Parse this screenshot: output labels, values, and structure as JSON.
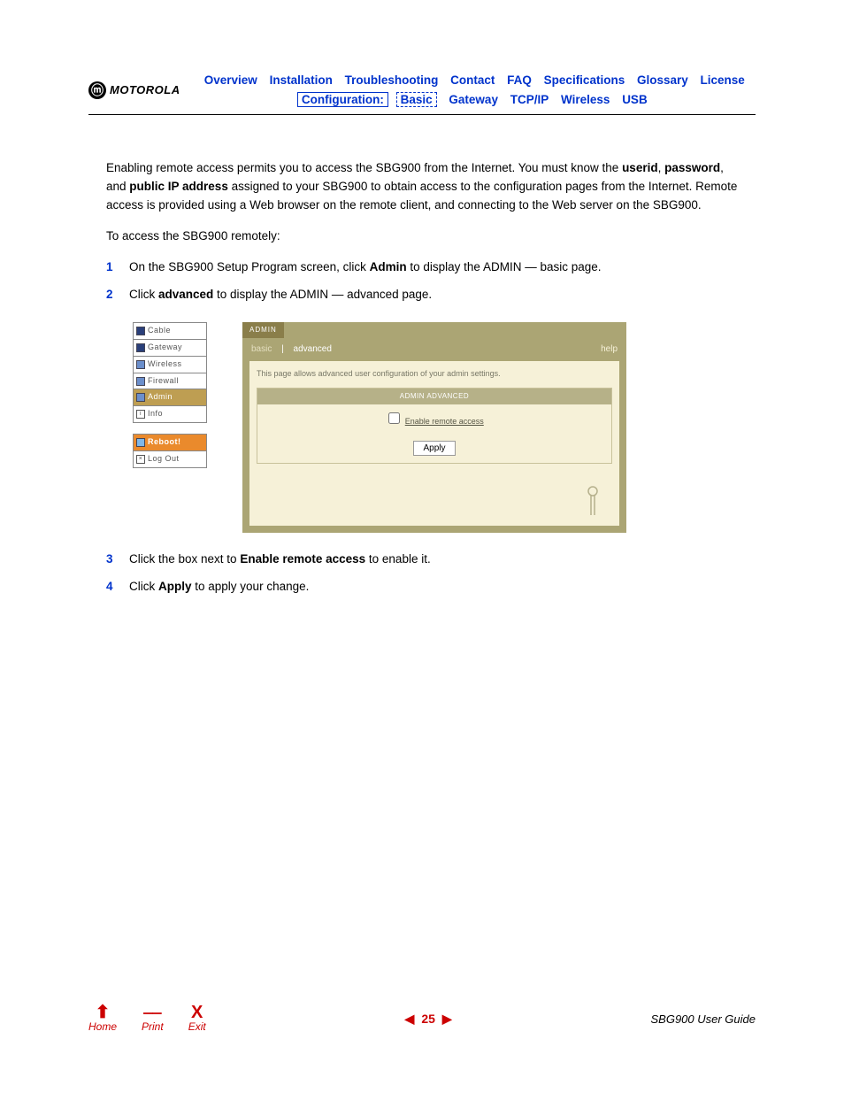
{
  "brand": "MOTOROLA",
  "nav": {
    "row1": [
      "Overview",
      "Installation",
      "Troubleshooting",
      "Contact",
      "FAQ",
      "Specifications",
      "Glossary",
      "License"
    ],
    "config_label": "Configuration:",
    "row2": [
      "Basic",
      "Gateway",
      "TCP/IP",
      "Wireless",
      "USB"
    ]
  },
  "body": {
    "p1a": "Enabling remote access permits you to access the SBG900 from the Internet. You must know the ",
    "p1_userid": "userid",
    "p1b": ", ",
    "p1_password": "password",
    "p1c": ", and ",
    "p1_pubip": "public IP address",
    "p1d": " assigned to your SBG900 to obtain access to the configuration pages from the Internet. Remote access is provided using a Web browser on the remote client, and connecting to the Web server on the SBG900.",
    "p2": "To access the SBG900 remotely:",
    "s1a": "On the SBG900 Setup Program screen, click ",
    "s1_admin": "Admin",
    "s1b": " to display the ADMIN — basic page.",
    "s2a": "Click ",
    "s2_adv": "advanced",
    "s2b": " to display the ADMIN — advanced page.",
    "s3a": "Click the box next to ",
    "s3_era": "Enable remote access",
    "s3b": " to enable it.",
    "s4a": "Click ",
    "s4_apply": "Apply",
    "s4b": " to apply your change."
  },
  "step_nums": [
    "1",
    "2",
    "3",
    "4"
  ],
  "side_menu": {
    "cable": "Cable",
    "gateway": "Gateway",
    "wireless": "Wireless",
    "firewall": "Firewall",
    "admin": "Admin",
    "info": "Info",
    "reboot": "Reboot!",
    "logout": "Log Out"
  },
  "admin_panel": {
    "tab": "ADMIN",
    "subtab_basic": "basic",
    "subtab_advanced": "advanced",
    "help": "help",
    "desc": "This page allows advanced user configuration of your admin settings.",
    "section_hd": "ADMIN ADVANCED",
    "checkbox_label": "Enable remote access",
    "apply": "Apply"
  },
  "footer": {
    "home": "Home",
    "print": "Print",
    "exit": "Exit",
    "exit_glyph": "X",
    "page": "25",
    "guide": "SBG900 User Guide"
  }
}
